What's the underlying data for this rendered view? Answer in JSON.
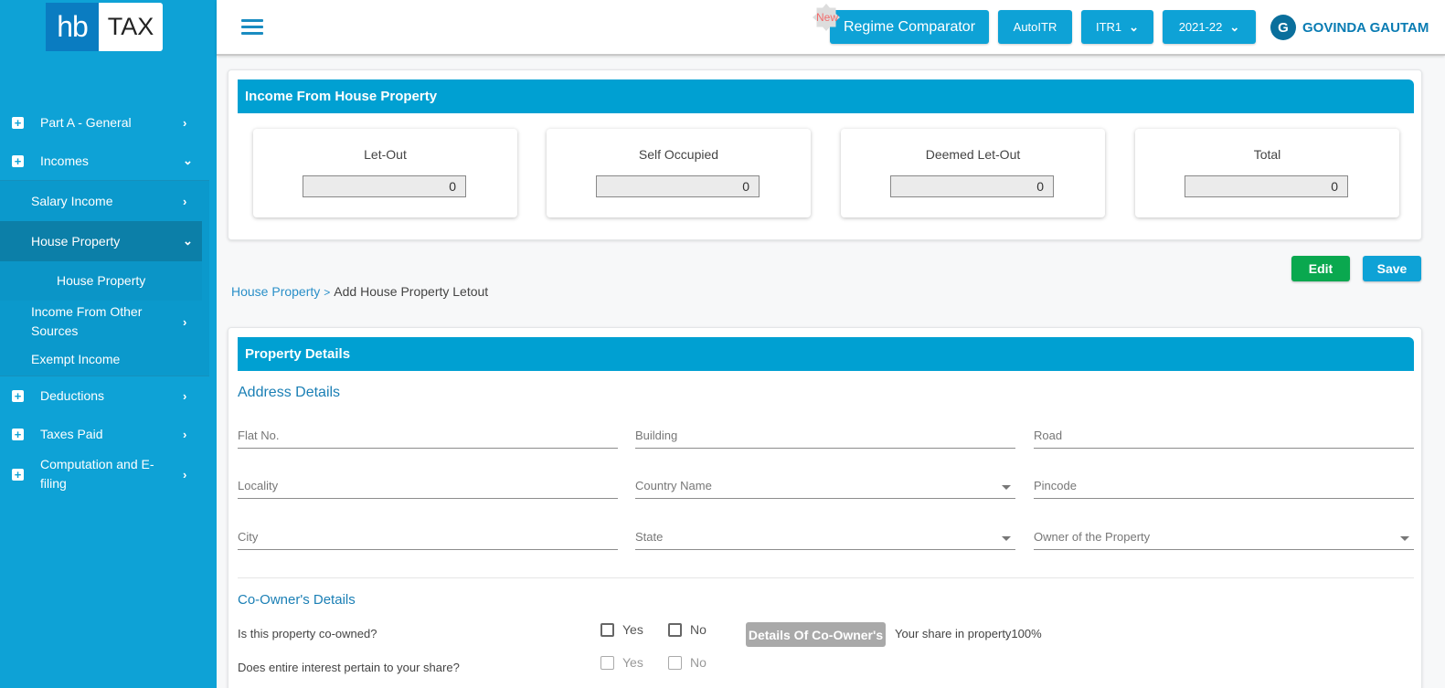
{
  "logo": {
    "left": "hb",
    "right": "TAX"
  },
  "sidebar": {
    "items": [
      {
        "label": "Part A - General",
        "icon": "plus-square-icon",
        "chevron": "›"
      },
      {
        "label": "Incomes",
        "icon": "plus-square-icon",
        "chevron": "⌄"
      },
      {
        "label": "Salary Income",
        "chevron": "›"
      },
      {
        "label": "House Property",
        "chevron": "⌄"
      },
      {
        "label": "House Property"
      },
      {
        "label": "Income From Other Sources",
        "chevron": "›"
      },
      {
        "label": "Exempt Income"
      },
      {
        "label": "Deductions",
        "icon": "plus-square-icon",
        "chevron": "›"
      },
      {
        "label": "Taxes Paid",
        "icon": "plus-square-icon",
        "chevron": "›"
      },
      {
        "label": "Computation and E-filing",
        "icon": "plus-square-icon",
        "chevron": "›"
      }
    ]
  },
  "header": {
    "new_badge": "New",
    "regime_comparator": "Regime Comparator",
    "autoitr": "AutoITR",
    "itr_select": "ITR1",
    "year_select": "2021-22",
    "user_initial": "G",
    "user_name": "GOVINDA GAUTAM"
  },
  "summary": {
    "title": "Income From House Property",
    "boxes": [
      {
        "label": "Let-Out",
        "value": "0"
      },
      {
        "label": "Self Occupied",
        "value": "0"
      },
      {
        "label": "Deemed Let-Out",
        "value": "0"
      },
      {
        "label": "Total",
        "value": "0"
      }
    ]
  },
  "actions": {
    "edit": "Edit",
    "save": "Save"
  },
  "breadcrumb": {
    "link": "House Property",
    "separator": ">",
    "current": "Add House Property Letout"
  },
  "property": {
    "title": "Property Details",
    "address_title": "Address Details",
    "fields": {
      "flat": "Flat No.",
      "building": "Building",
      "road": "Road",
      "locality": "Locality",
      "country": "Country Name",
      "pincode": "Pincode",
      "city": "City",
      "state": "State",
      "owner": "Owner of the Property"
    },
    "coowner_title": "Co-Owner's Details",
    "q1": "Is this property co-owned?",
    "q2": "Does entire interest pertain to your share?",
    "yes": "Yes",
    "no": "No",
    "coowner_button": "Details Of Co-Owner's",
    "share_text": "Your share in property100%"
  }
}
